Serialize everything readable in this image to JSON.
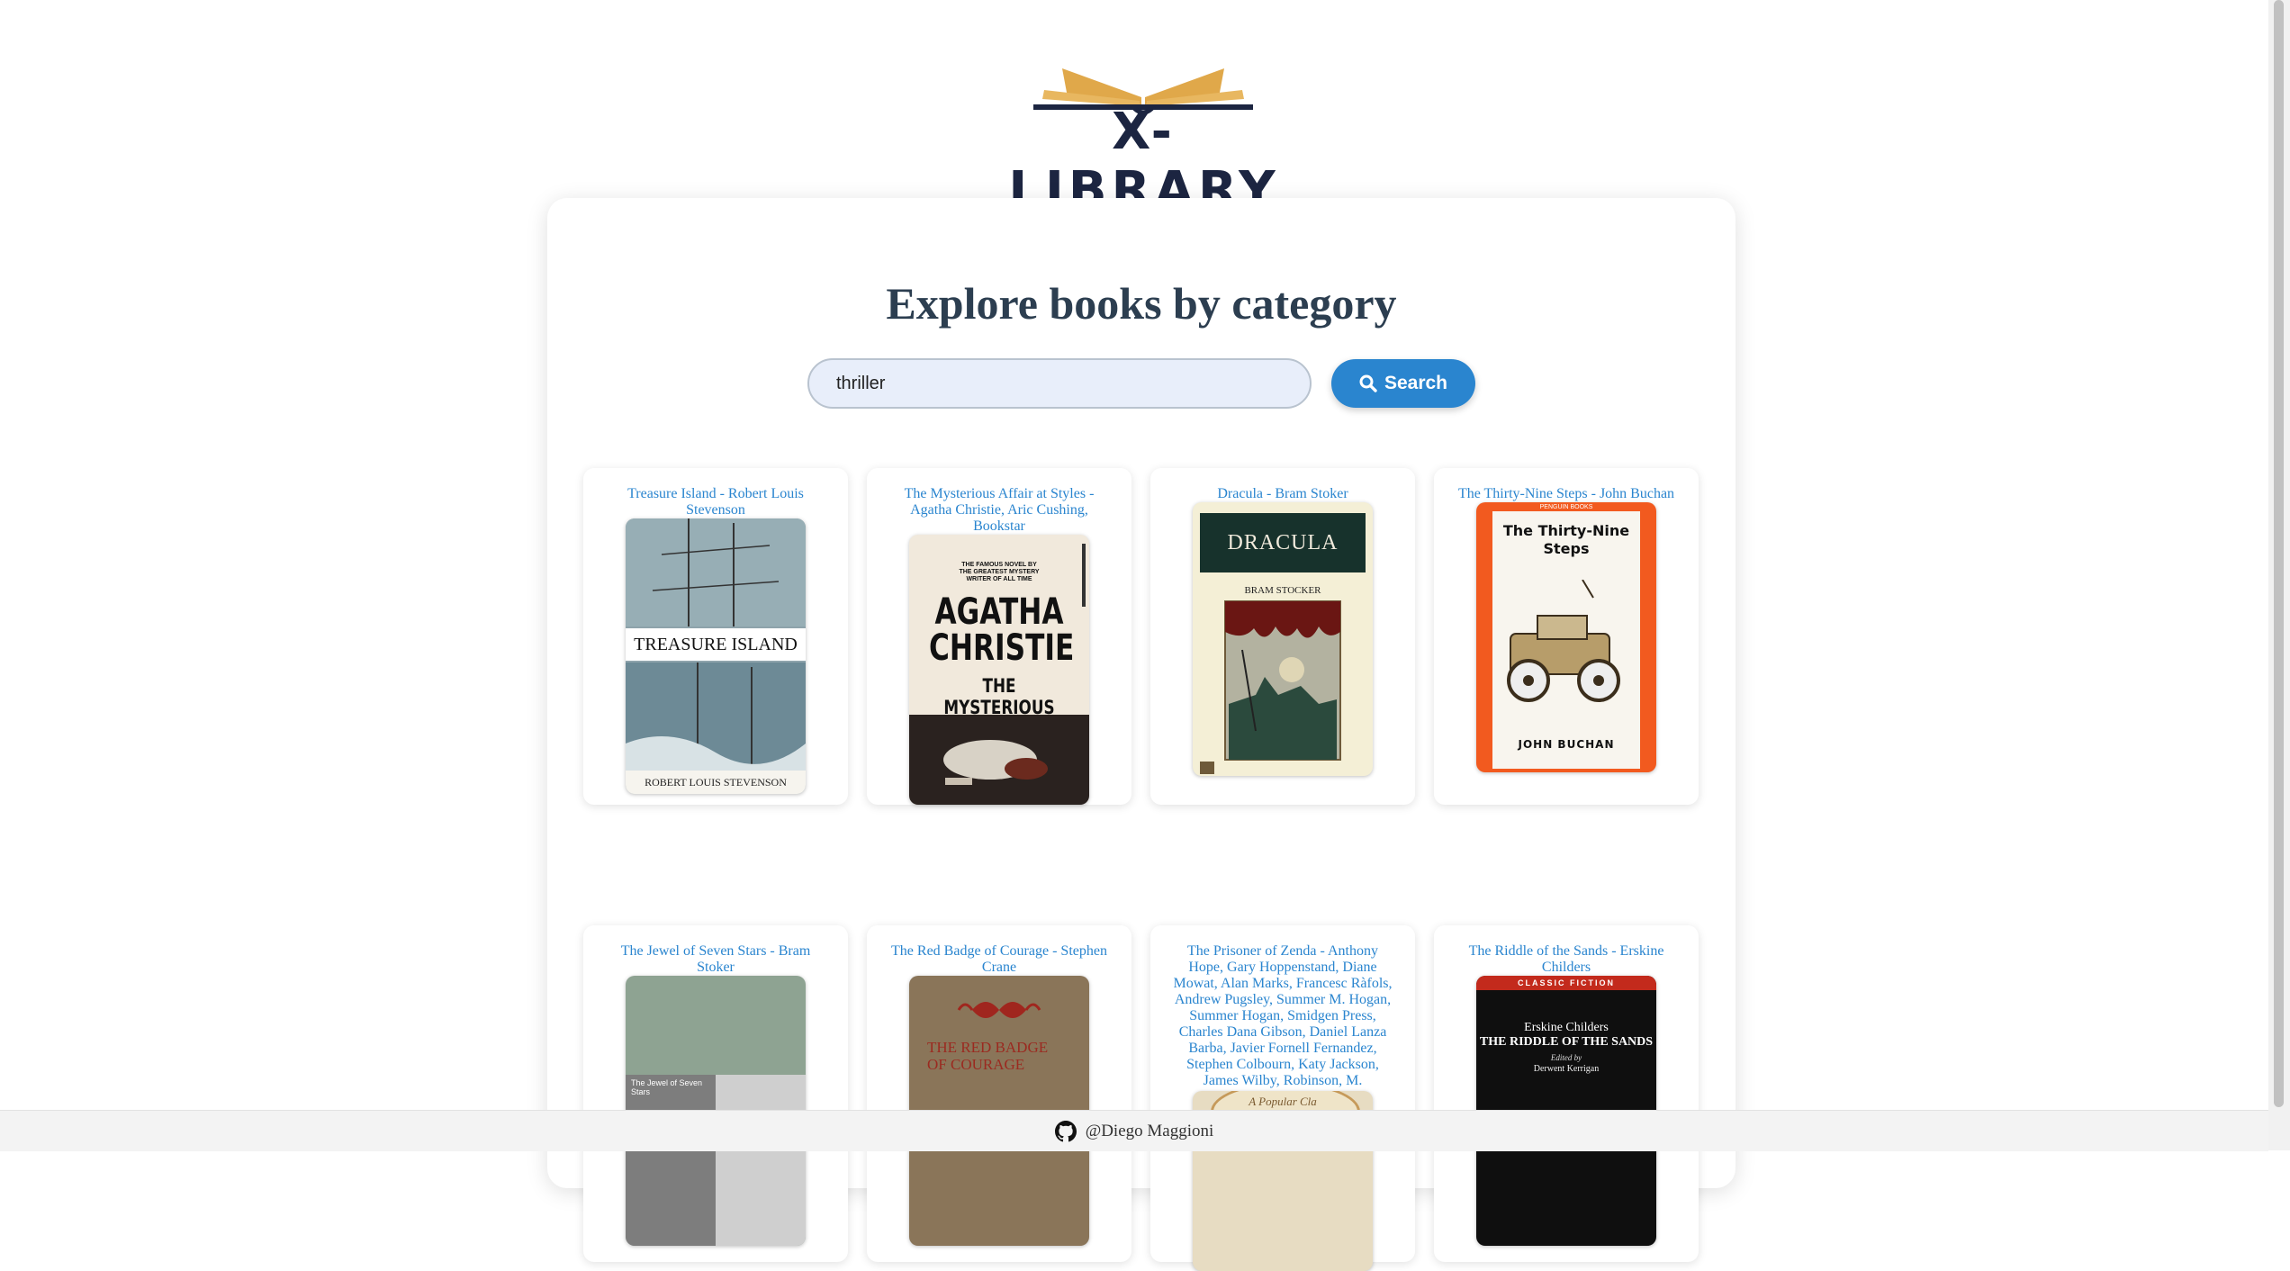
{
  "app": {
    "logo_text": "X-LIBRARY"
  },
  "main": {
    "heading": "Explore books by category",
    "search": {
      "value": "thriller",
      "button_label": "Search"
    }
  },
  "books": [
    {
      "title": "Treasure Island - Robert Louis Stevenson",
      "cover_text": [
        "TREASURE ISLAND",
        "ROBERT LOUIS STEVENSON"
      ]
    },
    {
      "title": "The Mysterious Affair at Styles - Agatha Christie, Aric Cushing, Bookstar",
      "cover_text": [
        "THE FAMOUS NOVEL BY THE GREATEST MYSTERY WRITER OF ALL TIME",
        "AGATHA CHRISTIE",
        "THE MYSTERIOUS AFFAIR AT STYLES"
      ]
    },
    {
      "title": "Dracula - Bram Stoker",
      "cover_text": [
        "DRACULA",
        "BRAM STOCKER"
      ]
    },
    {
      "title": "The Thirty-Nine Steps - John Buchan",
      "cover_text": [
        "PENGUIN BOOKS",
        "The Thirty-Nine Steps",
        "JOHN BUCHAN"
      ]
    },
    {
      "title": "The Jewel of Seven Stars - Bram Stoker",
      "cover_text": [
        "The Jewel of Seven Stars"
      ]
    },
    {
      "title": "The Red Badge of Courage - Stephen Crane",
      "cover_text": [
        "THE RED BADGE OF COURAGE"
      ]
    },
    {
      "title": "The Prisoner of Zenda - Anthony Hope, Gary Hoppenstand, Diane Mowat, Alan Marks, Francesc Ràfols, Andrew Pugsley, Summer M. Hogan, Summer Hogan, Smidgen Press, Charles Dana Gibson, Daniel Lanza Barba, Javier Fornell Fernandez, Stephen Colbourn, Katy Jackson, James Wilby, Robinson, M.",
      "cover_text": [
        "A Popular Cla"
      ]
    },
    {
      "title": "The Riddle of the Sands - Erskine Childers",
      "cover_text": [
        "CLASSIC FICTION",
        "Erskine Childers",
        "THE RIDDLE OF THE SANDS",
        "Edited by",
        "Derwent Kerrigan"
      ]
    }
  ],
  "footer": {
    "text": "@Diego Maggioni",
    "icon": "github-icon"
  },
  "colors": {
    "accent": "#2a85cf",
    "heading": "#2c3e50",
    "logo_dark": "#1c2541",
    "logo_gold": "#e0a84a"
  }
}
